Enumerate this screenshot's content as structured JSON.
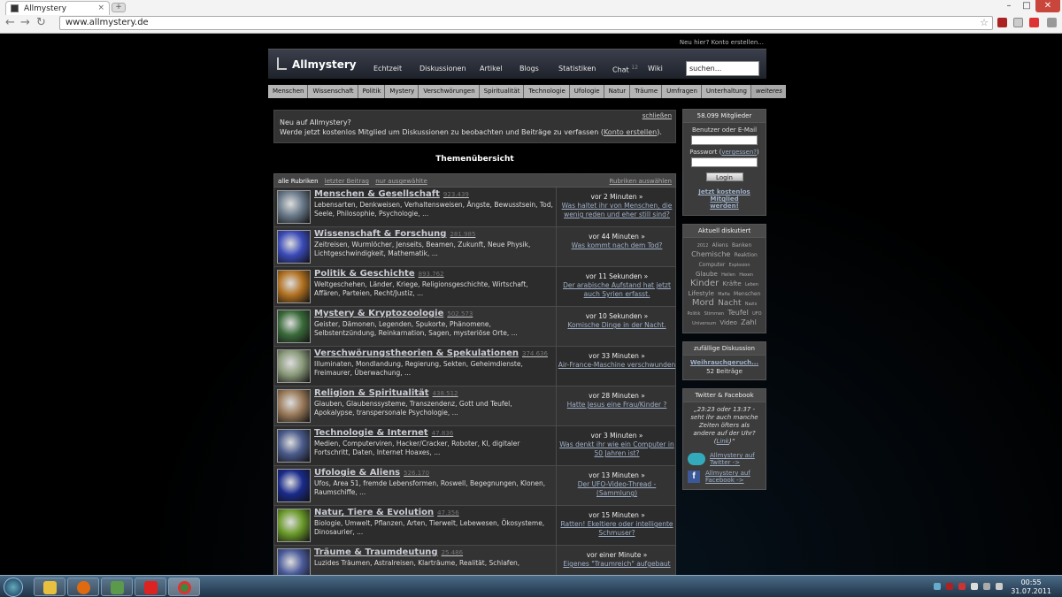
{
  "browser": {
    "tab_title": "Allmystery",
    "tab_close": "×",
    "new_tab": "+",
    "url": "www.allmystery.de",
    "back": "←",
    "forward": "→",
    "reload": "↻",
    "star": "☆",
    "win_min": "–",
    "win_max": "□",
    "win_close": "✕"
  },
  "site": {
    "register_link": "Neu hier? Konto erstellen...",
    "logo": "Allmystery",
    "nav": [
      "Echtzeit",
      "Diskussionen",
      "Artikel",
      "Blogs",
      "Statistiken",
      "Chat",
      "Wiki"
    ],
    "chat_count": "12",
    "search_placeholder": "suchen...",
    "categories": [
      "Menschen",
      "Wissenschaft",
      "Politik",
      "Mystery",
      "Verschwörungen",
      "Spiritualität",
      "Technologie",
      "Ufologie",
      "Natur",
      "Träume",
      "Umfragen",
      "Unterhaltung",
      "weiteres"
    ]
  },
  "promo": {
    "line1": "Neu auf Allmystery?",
    "line2": "Werde jetzt kostenlos Mitglied um Diskussionen zu beobachten und Beiträge zu verfassen (",
    "link": "Konto erstellen",
    "line2_end": ").",
    "close": "schließen"
  },
  "themes_title": "Themenübersicht",
  "filter": {
    "all": "alle Rubriken",
    "last": "letzter Beitrag",
    "selected": "nur ausgewählte",
    "choose": "Rubriken auswählen"
  },
  "rows": [
    {
      "title": "Menschen & Gesellschaft",
      "count": "923.439",
      "desc": "Lebensarten, Denkweisen, Verhaltensweisen, Ängste, Bewusstsein, Tod, Seele, Philosophie, Psychologie, ...",
      "time": "vor 2 Minuten »",
      "last": "Was haltet ihr von Menschen, die wenig reden und eher still sind?",
      "color": "#6a7a8a"
    },
    {
      "title": "Wissenschaft & Forschung",
      "count": "281.985",
      "desc": "Zeitreisen, Wurmlöcher, Jenseits, Beamen, Zukunft, Neue Physik, Lichtgeschwindigkeit, Mathematik, ...",
      "time": "vor 44 Minuten »",
      "last": "Was kommt nach dem Tod?",
      "color": "#3a4ab8"
    },
    {
      "title": "Politik & Geschichte",
      "count": "893.762",
      "desc": "Weltgeschehen, Länder, Kriege, Religionsgeschichte, Wirtschaft, Affären, Parteien, Recht/Justiz, ...",
      "time": "vor 11 Sekunden »",
      "last": "Der arabische Aufstand hat jetzt auch Syrien erfasst.",
      "color": "#b07020"
    },
    {
      "title": "Mystery & Kryptozoologie",
      "count": "502.573",
      "desc": "Geister, Dämonen, Legenden, Spukorte, Phänomene, Selbstentzündung, Reinkarnation, Sagen, mysteriöse Orte, ...",
      "time": "vor 10 Sekunden »",
      "last": "Komische Dinge in der Nacht.",
      "color": "#3a6a3a"
    },
    {
      "title": "Verschwörungstheorien & Spekulationen",
      "count": "374.636",
      "desc": "Illuminaten, Mondlandung, Regierung, Sekten, Geheimdienste, Freimaurer, Überwachung, ...",
      "time": "vor 33 Minuten »",
      "last": "Air-France-Maschine verschwunden",
      "color": "#8a9a7a"
    },
    {
      "title": "Religion & Spiritualität",
      "count": "438.512",
      "desc": "Glauben, Glaubenssysteme, Transzendenz, Gott und Teufel, Apokalypse, transpersonale Psychologie, ...",
      "time": "vor 28 Minuten »",
      "last": "Hatte Jesus eine Frau/Kinder ?",
      "color": "#9a7a5a"
    },
    {
      "title": "Technologie & Internet",
      "count": "47.836",
      "desc": "Medien, Computerviren, Hacker/Cracker, Roboter, KI, digitaler Fortschritt, Daten, Internet Hoaxes, ...",
      "time": "vor 3 Minuten »",
      "last": "Was denkt ihr wie ein Computer in 50 Jahren ist?",
      "color": "#4a5a8a"
    },
    {
      "title": "Ufologie & Aliens",
      "count": "526.170",
      "desc": "Ufos, Area 51, fremde Lebensformen, Roswell, Begegnungen, Klonen, Raumschiffe, ...",
      "time": "vor 13 Minuten »",
      "last": "Der UFO-Video-Thread - (Sammlung)",
      "color": "#1a2a8a"
    },
    {
      "title": "Natur, Tiere & Evolution",
      "count": "47.356",
      "desc": "Biologie, Umwelt, Pflanzen, Arten, Tierwelt, Lebewesen, Ökosysteme, Dinosaurier, ...",
      "time": "vor 15 Minuten »",
      "last": "Ratten! Ekeltiere oder intelligente Schmuser?",
      "color": "#6a9a2a"
    },
    {
      "title": "Träume & Traumdeutung",
      "count": "25.486",
      "desc": "Luzides Träumen, Astralreisen, Klarträume, Realität, Schlafen,",
      "time": "vor einer Minute »",
      "last": "Eigenes \"Traumreich\" aufgebaut",
      "color": "#4a5a9a"
    }
  ],
  "sidebar": {
    "members": "58.099 Mitglieder",
    "user_label": "Benutzer oder E-Mail",
    "pass_label": "Passwort (",
    "forgot": "vergessen?",
    "pass_end": ")",
    "login": "Login",
    "join": "Jetzt kostenlos Mitglied werden!",
    "discussed_title": "Aktuell diskutiert",
    "tags": [
      "2012",
      "Aliens",
      "Banken",
      "Chemische",
      "Reaktion",
      "Computer",
      "Explosion",
      "Glaube",
      "Heilen",
      "Hexen",
      "Kinder",
      "Kräfte",
      "Leben",
      "Lifestyle",
      "Mafia",
      "Menschen",
      "Mord",
      "Nacht",
      "Nazis",
      "Politik",
      "Stimmen",
      "Teufel",
      "UFO",
      "Universum",
      "Video",
      "Zahl"
    ],
    "random_title": "zufällige Diskussion",
    "random_link": "Weihrauchgeruch...",
    "random_count": "52 Beiträge",
    "tf_title": "Twitter & Facebook",
    "quote": "„23:23 oder 13:37 - seht ihr auch manche Zeiten öfters als andere auf der Uhr? (",
    "quote_link": "Link",
    "quote_end": ")“",
    "twitter": "Allmystery auf Twitter ->",
    "facebook": "Allmystery auf Facebook ->"
  },
  "taskbar": {
    "time": "00:55",
    "date": "31.07.2011"
  }
}
